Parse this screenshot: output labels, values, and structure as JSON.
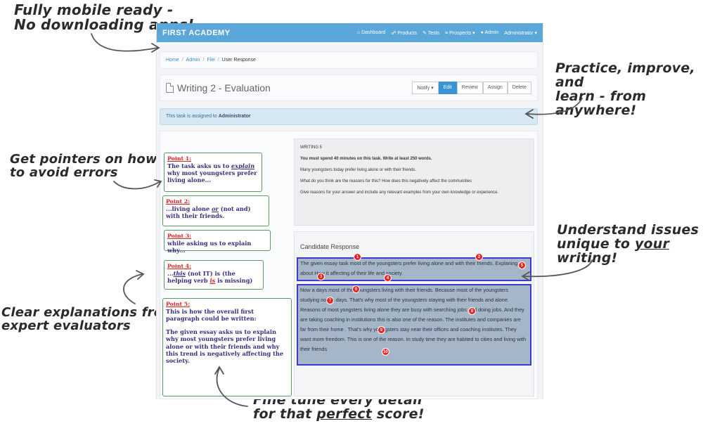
{
  "callouts": {
    "mobile": [
      "Fully mobile ready -",
      "No downloading apps!"
    ],
    "practice": [
      "Practice, improve, and",
      "learn - from anywhere!"
    ],
    "pointers": [
      "Get pointers on how",
      "to avoid errors"
    ],
    "issues_line1": "Understand issues",
    "issues_line2_pre": "unique to ",
    "issues_line2_em": "your",
    "issues_line2_post": " writing!",
    "explanations": [
      "Clear explanations from",
      "expert evaluators"
    ],
    "finetune_line1": "Fine tune every detail",
    "finetune_line2_pre": "for that ",
    "finetune_line2_em": "perfect",
    "finetune_line2_post": " score!"
  },
  "navbar": {
    "brand": "FIRST ACADEMY",
    "items": [
      "Dashboard",
      "Products",
      "Tests",
      "Prospects",
      "Admin",
      "Administrator"
    ]
  },
  "breadcrumb": [
    "Home",
    "Admin",
    "File",
    "User Response"
  ],
  "page": {
    "title": "Writing 2 - Evaluation",
    "actions": [
      "Notify",
      "Edit",
      "Review",
      "Assign",
      "Delete"
    ],
    "alert_pre": "This task is assigned to ",
    "alert_user": "Administrator"
  },
  "points": [
    {
      "label": "Point 1:",
      "text_pre": "The task asks us to ",
      "text_em": "explain",
      "text_post": " why most youngsters prefer living alone..."
    },
    {
      "label": "Point 2:",
      "text_pre": "...living alone ",
      "text_em": "or",
      "text_post": " (not and) with their friends."
    },
    {
      "label": "Point 3:",
      "text": "while asking us to explain why..."
    },
    {
      "label": "Point 4:",
      "text_pre": "...",
      "text_em": "this",
      "text_mid": " (not IT) is (the helping verb ",
      "text_red": "is",
      "text_post": " is missing)"
    },
    {
      "label": "Point 5:",
      "text": "This is how the overall first paragraph could be written:",
      "text2": "The given essay asks us to explain why most youngsters prefer living alone or with their friends and why this trend is negatively affecting the society."
    }
  ],
  "writing_task": {
    "heading": "WRITING 5",
    "instruction": "You must spend 40 minutes on this task. Write at least 250 words.",
    "prompt1": "Many youngsters today prefer living alone or with their friends.",
    "prompt2": "What do you think are the reasons for this? How does this negatively affect the communities",
    "prompt3": "Give reasons for your answer and include any relevant examples from your own knowledge or experience."
  },
  "response": {
    "title": "Candidate Response",
    "para1": "The given essay task most of the youngsters prefer living alone and with their friends. Explaning about How it affecting of their life and society.",
    "para2": "Now a days most of the youngsters living with their friends. Because most of the youngsters studying now a days. That's why most of  the youngsters staying with their friends and alone. Reasons of most yongsters living alone they are busy with searching jobs and doing jobs. And they are taking coaching in institutions this is also one of the reason. The institutes and companies are far from their home . That's why youngsters stay near their offices and coaching institutes. They want more freedom. This is one of the reason. In study time they are habited to cities and living with their friends",
    "markers": [
      "1",
      "2",
      "3",
      "4",
      "5",
      "6",
      "7",
      "8",
      "9",
      "10"
    ]
  },
  "colors": {
    "navbar": "#5ba7d9",
    "active_button": "#3a93d4",
    "highlight_border": "#3f3ad6",
    "marker": "#e22222",
    "point_border": "#5a9a6a"
  }
}
